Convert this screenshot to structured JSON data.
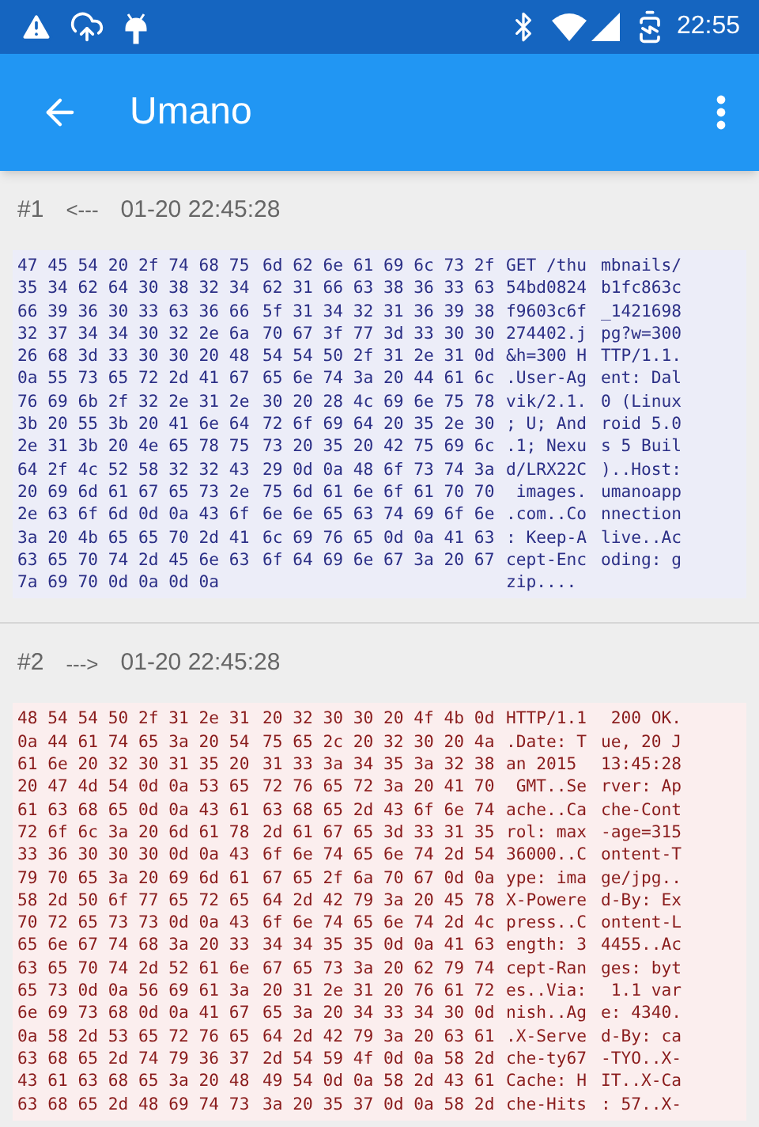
{
  "status_bar": {
    "time": "22:55"
  },
  "app_bar": {
    "title": "Umano"
  },
  "packets": [
    {
      "number": "#1",
      "direction": "<---",
      "time": "01-20 22:45:28",
      "kind": "request",
      "rows": [
        {
          "hex": [
            "47 45 54 20 2f 74 68 75",
            "6d 62 6e 61 69 6c 73 2f"
          ],
          "text": [
            "GET /thu",
            "mbnails/"
          ]
        },
        {
          "hex": [
            "35 34 62 64 30 38 32 34",
            "62 31 66 63 38 36 33 63"
          ],
          "text": [
            "54bd0824",
            "b1fc863c"
          ]
        },
        {
          "hex": [
            "66 39 36 30 33 63 36 66",
            "5f 31 34 32 31 36 39 38"
          ],
          "text": [
            "f9603c6f",
            "_1421698"
          ]
        },
        {
          "hex": [
            "32 37 34 34 30 32 2e 6a",
            "70 67 3f 77 3d 33 30 30"
          ],
          "text": [
            "274402.j",
            "pg?w=300"
          ]
        },
        {
          "hex": [
            "26 68 3d 33 30 30 20 48",
            "54 54 50 2f 31 2e 31 0d"
          ],
          "text": [
            "&h=300 H",
            "TTP/1.1."
          ]
        },
        {
          "hex": [
            "0a 55 73 65 72 2d 41 67",
            "65 6e 74 3a 20 44 61 6c"
          ],
          "text": [
            ".User-Ag",
            "ent: Dal"
          ]
        },
        {
          "hex": [
            "76 69 6b 2f 32 2e 31 2e",
            "30 20 28 4c 69 6e 75 78"
          ],
          "text": [
            "vik/2.1.",
            "0 (Linux"
          ]
        },
        {
          "hex": [
            "3b 20 55 3b 20 41 6e 64",
            "72 6f 69 64 20 35 2e 30"
          ],
          "text": [
            "; U; And",
            "roid 5.0"
          ]
        },
        {
          "hex": [
            "2e 31 3b 20 4e 65 78 75",
            "73 20 35 20 42 75 69 6c"
          ],
          "text": [
            ".1; Nexu",
            "s 5 Buil"
          ]
        },
        {
          "hex": [
            "64 2f 4c 52 58 32 32 43",
            "29 0d 0a 48 6f 73 74 3a"
          ],
          "text": [
            "d/LRX22C",
            ")..Host:"
          ]
        },
        {
          "hex": [
            "20 69 6d 61 67 65 73 2e",
            "75 6d 61 6e 6f 61 70 70"
          ],
          "text": [
            " images.",
            "umanoapp"
          ]
        },
        {
          "hex": [
            "2e 63 6f 6d 0d 0a 43 6f",
            "6e 6e 65 63 74 69 6f 6e"
          ],
          "text": [
            ".com..Co",
            "nnection"
          ]
        },
        {
          "hex": [
            "3a 20 4b 65 65 70 2d 41",
            "6c 69 76 65 0d 0a 41 63"
          ],
          "text": [
            ": Keep-A",
            "live..Ac"
          ]
        },
        {
          "hex": [
            "63 65 70 74 2d 45 6e 63",
            "6f 64 69 6e 67 3a 20 67"
          ],
          "text": [
            "cept-Enc",
            "oding: g"
          ]
        },
        {
          "hex": [
            "7a 69 70 0d 0a 0d 0a"
          ],
          "text": [
            "zip...."
          ]
        }
      ]
    },
    {
      "number": "#2",
      "direction": "--->",
      "time": "01-20 22:45:28",
      "kind": "response",
      "rows": [
        {
          "hex": [
            "48 54 54 50 2f 31 2e 31",
            "20 32 30 30 20 4f 4b 0d"
          ],
          "text": [
            "HTTP/1.1",
            " 200 OK."
          ]
        },
        {
          "hex": [
            "0a 44 61 74 65 3a 20 54",
            "75 65 2c 20 32 30 20 4a"
          ],
          "text": [
            ".Date: T",
            "ue, 20 J"
          ]
        },
        {
          "hex": [
            "61 6e 20 32 30 31 35 20",
            "31 33 3a 34 35 3a 32 38"
          ],
          "text": [
            "an 2015 ",
            "13:45:28"
          ]
        },
        {
          "hex": [
            "20 47 4d 54 0d 0a 53 65",
            "72 76 65 72 3a 20 41 70"
          ],
          "text": [
            " GMT..Se",
            "rver: Ap"
          ]
        },
        {
          "hex": [
            "61 63 68 65 0d 0a 43 61",
            "63 68 65 2d 43 6f 6e 74"
          ],
          "text": [
            "ache..Ca",
            "che-Cont"
          ]
        },
        {
          "hex": [
            "72 6f 6c 3a 20 6d 61 78",
            "2d 61 67 65 3d 33 31 35"
          ],
          "text": [
            "rol: max",
            "-age=315"
          ]
        },
        {
          "hex": [
            "33 36 30 30 30 0d 0a 43",
            "6f 6e 74 65 6e 74 2d 54"
          ],
          "text": [
            "36000..C",
            "ontent-T"
          ]
        },
        {
          "hex": [
            "79 70 65 3a 20 69 6d 61",
            "67 65 2f 6a 70 67 0d 0a"
          ],
          "text": [
            "ype: ima",
            "ge/jpg.."
          ]
        },
        {
          "hex": [
            "58 2d 50 6f 77 65 72 65",
            "64 2d 42 79 3a 20 45 78"
          ],
          "text": [
            "X-Powere",
            "d-By: Ex"
          ]
        },
        {
          "hex": [
            "70 72 65 73 73 0d 0a 43",
            "6f 6e 74 65 6e 74 2d 4c"
          ],
          "text": [
            "press..C",
            "ontent-L"
          ]
        },
        {
          "hex": [
            "65 6e 67 74 68 3a 20 33",
            "34 34 35 35 0d 0a 41 63"
          ],
          "text": [
            "ength: 3",
            "4455..Ac"
          ]
        },
        {
          "hex": [
            "63 65 70 74 2d 52 61 6e",
            "67 65 73 3a 20 62 79 74"
          ],
          "text": [
            "cept-Ran",
            "ges: byt"
          ]
        },
        {
          "hex": [
            "65 73 0d 0a 56 69 61 3a",
            "20 31 2e 31 20 76 61 72"
          ],
          "text": [
            "es..Via:",
            " 1.1 var"
          ]
        },
        {
          "hex": [
            "6e 69 73 68 0d 0a 41 67",
            "65 3a 20 34 33 34 30 0d"
          ],
          "text": [
            "nish..Ag",
            "e: 4340."
          ]
        },
        {
          "hex": [
            "0a 58 2d 53 65 72 76 65",
            "64 2d 42 79 3a 20 63 61"
          ],
          "text": [
            ".X-Serve",
            "d-By: ca"
          ]
        },
        {
          "hex": [
            "63 68 65 2d 74 79 36 37",
            "2d 54 59 4f 0d 0a 58 2d"
          ],
          "text": [
            "che-ty67",
            "-TYO..X-"
          ]
        },
        {
          "hex": [
            "43 61 63 68 65 3a 20 48",
            "49 54 0d 0a 58 2d 43 61"
          ],
          "text": [
            "Cache: H",
            "IT..X-Ca"
          ]
        },
        {
          "hex": [
            "63 68 65 2d 48 69 74 73",
            "3a 20 35 37 0d 0a 58 2d"
          ],
          "text": [
            "che-Hits",
            ": 57..X-"
          ]
        }
      ]
    }
  ]
}
